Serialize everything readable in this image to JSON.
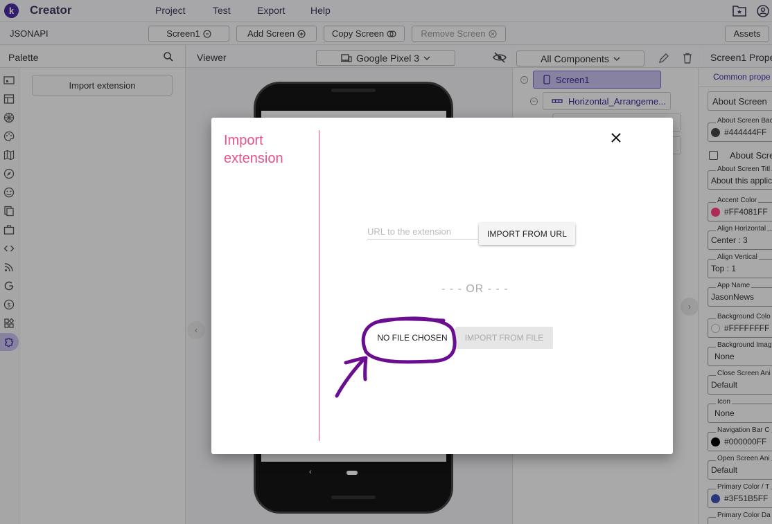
{
  "app": {
    "brand": "Creator",
    "menu": [
      "Project",
      "Test",
      "Export",
      "Help"
    ],
    "accent_color": "#4b2aa0"
  },
  "toolbar": {
    "project_name": "JSONAPI",
    "screen_select": "Screen1",
    "add_screen": "Add Screen",
    "copy_screen": "Copy Screen",
    "remove_screen": "Remove Screen",
    "assets": "Assets"
  },
  "palette": {
    "title": "Palette",
    "import_extension": "Import extension",
    "category_icons": [
      "user-interface-icon",
      "layout-icon",
      "media-icon",
      "drawing-icon",
      "maps-icon",
      "sensors-icon",
      "social-icon",
      "storage-icon",
      "connectivity-icon",
      "code-icon",
      "feed-icon",
      "google-icon",
      "monetization-icon",
      "blocks-icon",
      "extension-icon"
    ]
  },
  "viewer": {
    "title": "Viewer",
    "device": "Google Pixel 3"
  },
  "components": {
    "select_label": "All Components",
    "tree": [
      "Screen1",
      "Horizontal_Arrangeme..."
    ]
  },
  "properties": {
    "title": "Screen1 Prope",
    "tab": "Common prope",
    "about_screen": "About Screen",
    "about_screen_checkbox": "About Scree",
    "fields": [
      {
        "label": "About Screen Bac",
        "value": "#444444FF",
        "swatch": "#444444"
      },
      {
        "label": "About Screen Titl",
        "value": "About this applic",
        "swatch": null
      },
      {
        "label": "Accent Color",
        "value": "#FF4081FF",
        "swatch": "#FF4081"
      },
      {
        "label": "Align Horizontal",
        "value": "Center : 3",
        "swatch": null
      },
      {
        "label": "Align Vertical",
        "value": "Top : 1",
        "swatch": null
      },
      {
        "label": "App Name",
        "value": "JasonNews",
        "swatch": null
      },
      {
        "label": "Background Colo",
        "value": "#FFFFFFFF",
        "swatch": "#FFFFFF"
      },
      {
        "label": "Background Imag",
        "value": "None",
        "swatch": null
      },
      {
        "label": "Close Screen Ani",
        "value": "Default",
        "swatch": null
      },
      {
        "label": "Icon",
        "value": "None",
        "swatch": null
      },
      {
        "label": "Navigation Bar C",
        "value": "#000000FF",
        "swatch": "#000000"
      },
      {
        "label": "Open Screen Ani",
        "value": "Default",
        "swatch": null
      },
      {
        "label": "Primary Color / T",
        "value": "#3F51B5FF",
        "swatch": "#3F51B5"
      },
      {
        "label": "Primary Color Da",
        "value": "",
        "swatch": null
      }
    ]
  },
  "dialog": {
    "title": "Import extension",
    "url_placeholder": "URL to the extension",
    "import_url": "IMPORT FROM URL",
    "or": "- - - OR - - -",
    "no_file": "NO FILE CHOSEN",
    "import_file": "IMPORT FROM FILE",
    "title_color": "#e8518a",
    "annotation_color": "#6a0d91"
  }
}
